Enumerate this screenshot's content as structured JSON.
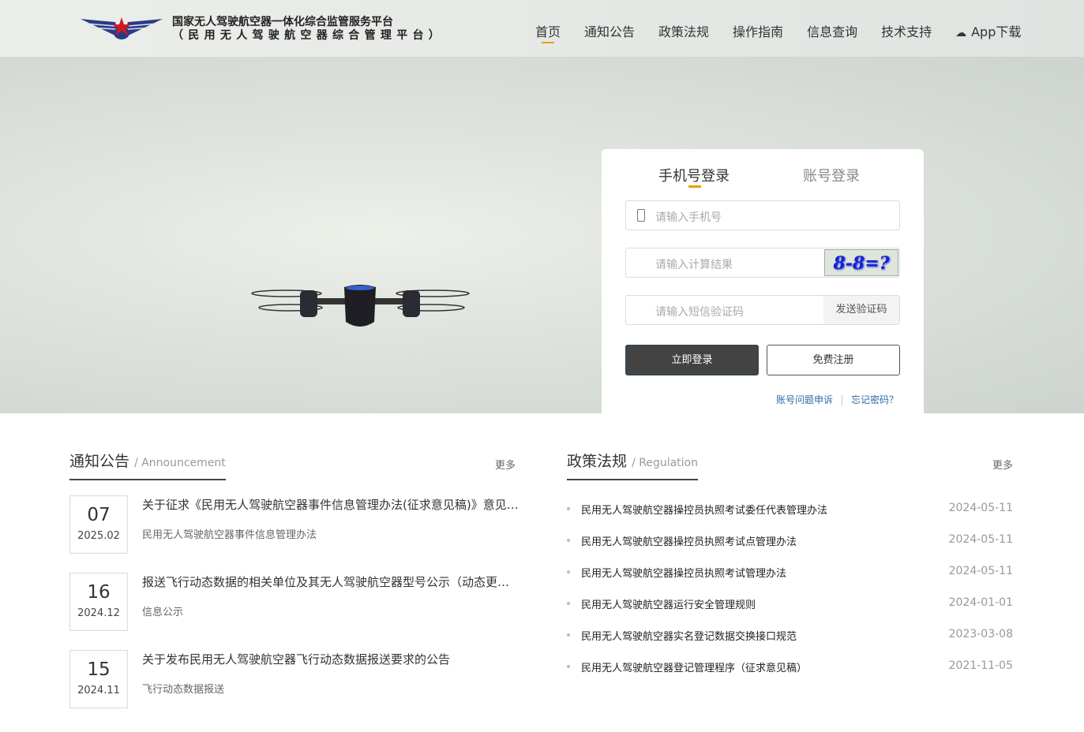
{
  "header": {
    "title_line1": "国家无人驾驶航空器一体化综合监管服务平台",
    "title_line2": "（民用无人驾驶航空器综合管理平台）",
    "nav": [
      "首页",
      "通知公告",
      "政策法规",
      "操作指南",
      "信息查询",
      "技术支持"
    ],
    "app_download": "App下载",
    "accent": "#e8a000"
  },
  "login": {
    "tabs": [
      "手机号登录",
      "账号登录"
    ],
    "phone_placeholder": "请输入手机号",
    "calc_placeholder": "请输入计算结果",
    "captcha": "8-8=?",
    "sms_placeholder": "请输入短信验证码",
    "send_code": "发送验证码",
    "login_btn": "立即登录",
    "register_btn": "免费注册",
    "appeal": "账号问题申诉",
    "forgot": "忘记密码？"
  },
  "announcements": {
    "title": "通知公告",
    "title_en": "/ Announcement",
    "more": "更多",
    "items": [
      {
        "day": "07",
        "month": "2025.02",
        "title": "关于征求《民用无人驾驶航空器事件信息管理办法(征求意见稿)》意见的通知",
        "sub": "民用无人驾驶航空器事件信息管理办法"
      },
      {
        "day": "16",
        "month": "2024.12",
        "title": "报送飞行动态数据的相关单位及其无人驾驶航空器型号公示（动态更新）",
        "sub": "信息公示"
      },
      {
        "day": "15",
        "month": "2024.11",
        "title": "关于发布民用无人驾驶航空器飞行动态数据报送要求的公告",
        "sub": "飞行动态数据报送"
      }
    ]
  },
  "regulations": {
    "title": "政策法规",
    "title_en": "/ Regulation",
    "more": "更多",
    "items": [
      {
        "title": "民用无人驾驶航空器操控员执照考试委任代表管理办法",
        "date": "2024-05-11"
      },
      {
        "title": "民用无人驾驶航空器操控员执照考试点管理办法",
        "date": "2024-05-11"
      },
      {
        "title": "民用无人驾驶航空器操控员执照考试管理办法",
        "date": "2024-05-11"
      },
      {
        "title": "民用无人驾驶航空器运行安全管理规则",
        "date": "2024-01-01"
      },
      {
        "title": "民用无人驾驶航空器实名登记数据交换接口规范",
        "date": "2023-03-08"
      },
      {
        "title": "民用无人驾驶航空器登记管理程序（征求意见稿）",
        "date": "2021-11-05"
      }
    ]
  }
}
